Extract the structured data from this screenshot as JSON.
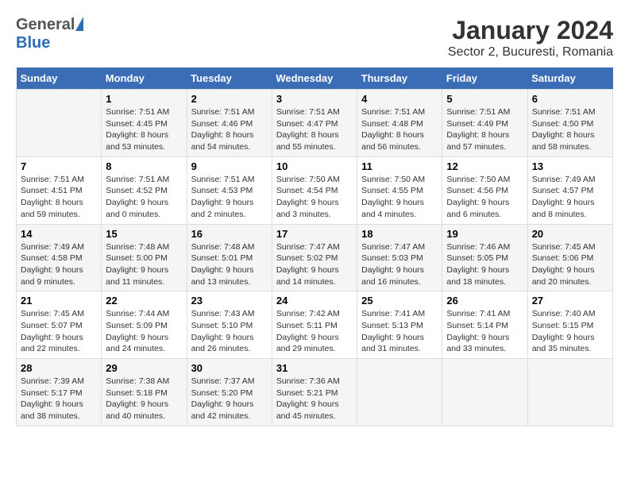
{
  "logo": {
    "general": "General",
    "blue": "Blue"
  },
  "title": "January 2024",
  "subtitle": "Sector 2, Bucuresti, Romania",
  "days_of_week": [
    "Sunday",
    "Monday",
    "Tuesday",
    "Wednesday",
    "Thursday",
    "Friday",
    "Saturday"
  ],
  "weeks": [
    [
      {
        "day": "",
        "info": ""
      },
      {
        "day": "1",
        "info": "Sunrise: 7:51 AM\nSunset: 4:45 PM\nDaylight: 8 hours\nand 53 minutes."
      },
      {
        "day": "2",
        "info": "Sunrise: 7:51 AM\nSunset: 4:46 PM\nDaylight: 8 hours\nand 54 minutes."
      },
      {
        "day": "3",
        "info": "Sunrise: 7:51 AM\nSunset: 4:47 PM\nDaylight: 8 hours\nand 55 minutes."
      },
      {
        "day": "4",
        "info": "Sunrise: 7:51 AM\nSunset: 4:48 PM\nDaylight: 8 hours\nand 56 minutes."
      },
      {
        "day": "5",
        "info": "Sunrise: 7:51 AM\nSunset: 4:49 PM\nDaylight: 8 hours\nand 57 minutes."
      },
      {
        "day": "6",
        "info": "Sunrise: 7:51 AM\nSunset: 4:50 PM\nDaylight: 8 hours\nand 58 minutes."
      }
    ],
    [
      {
        "day": "7",
        "info": "Sunrise: 7:51 AM\nSunset: 4:51 PM\nDaylight: 8 hours\nand 59 minutes."
      },
      {
        "day": "8",
        "info": "Sunrise: 7:51 AM\nSunset: 4:52 PM\nDaylight: 9 hours\nand 0 minutes."
      },
      {
        "day": "9",
        "info": "Sunrise: 7:51 AM\nSunset: 4:53 PM\nDaylight: 9 hours\nand 2 minutes."
      },
      {
        "day": "10",
        "info": "Sunrise: 7:50 AM\nSunset: 4:54 PM\nDaylight: 9 hours\nand 3 minutes."
      },
      {
        "day": "11",
        "info": "Sunrise: 7:50 AM\nSunset: 4:55 PM\nDaylight: 9 hours\nand 4 minutes."
      },
      {
        "day": "12",
        "info": "Sunrise: 7:50 AM\nSunset: 4:56 PM\nDaylight: 9 hours\nand 6 minutes."
      },
      {
        "day": "13",
        "info": "Sunrise: 7:49 AM\nSunset: 4:57 PM\nDaylight: 9 hours\nand 8 minutes."
      }
    ],
    [
      {
        "day": "14",
        "info": "Sunrise: 7:49 AM\nSunset: 4:58 PM\nDaylight: 9 hours\nand 9 minutes."
      },
      {
        "day": "15",
        "info": "Sunrise: 7:48 AM\nSunset: 5:00 PM\nDaylight: 9 hours\nand 11 minutes."
      },
      {
        "day": "16",
        "info": "Sunrise: 7:48 AM\nSunset: 5:01 PM\nDaylight: 9 hours\nand 13 minutes."
      },
      {
        "day": "17",
        "info": "Sunrise: 7:47 AM\nSunset: 5:02 PM\nDaylight: 9 hours\nand 14 minutes."
      },
      {
        "day": "18",
        "info": "Sunrise: 7:47 AM\nSunset: 5:03 PM\nDaylight: 9 hours\nand 16 minutes."
      },
      {
        "day": "19",
        "info": "Sunrise: 7:46 AM\nSunset: 5:05 PM\nDaylight: 9 hours\nand 18 minutes."
      },
      {
        "day": "20",
        "info": "Sunrise: 7:45 AM\nSunset: 5:06 PM\nDaylight: 9 hours\nand 20 minutes."
      }
    ],
    [
      {
        "day": "21",
        "info": "Sunrise: 7:45 AM\nSunset: 5:07 PM\nDaylight: 9 hours\nand 22 minutes."
      },
      {
        "day": "22",
        "info": "Sunrise: 7:44 AM\nSunset: 5:09 PM\nDaylight: 9 hours\nand 24 minutes."
      },
      {
        "day": "23",
        "info": "Sunrise: 7:43 AM\nSunset: 5:10 PM\nDaylight: 9 hours\nand 26 minutes."
      },
      {
        "day": "24",
        "info": "Sunrise: 7:42 AM\nSunset: 5:11 PM\nDaylight: 9 hours\nand 29 minutes."
      },
      {
        "day": "25",
        "info": "Sunrise: 7:41 AM\nSunset: 5:13 PM\nDaylight: 9 hours\nand 31 minutes."
      },
      {
        "day": "26",
        "info": "Sunrise: 7:41 AM\nSunset: 5:14 PM\nDaylight: 9 hours\nand 33 minutes."
      },
      {
        "day": "27",
        "info": "Sunrise: 7:40 AM\nSunset: 5:15 PM\nDaylight: 9 hours\nand 35 minutes."
      }
    ],
    [
      {
        "day": "28",
        "info": "Sunrise: 7:39 AM\nSunset: 5:17 PM\nDaylight: 9 hours\nand 38 minutes."
      },
      {
        "day": "29",
        "info": "Sunrise: 7:38 AM\nSunset: 5:18 PM\nDaylight: 9 hours\nand 40 minutes."
      },
      {
        "day": "30",
        "info": "Sunrise: 7:37 AM\nSunset: 5:20 PM\nDaylight: 9 hours\nand 42 minutes."
      },
      {
        "day": "31",
        "info": "Sunrise: 7:36 AM\nSunset: 5:21 PM\nDaylight: 9 hours\nand 45 minutes."
      },
      {
        "day": "",
        "info": ""
      },
      {
        "day": "",
        "info": ""
      },
      {
        "day": "",
        "info": ""
      }
    ]
  ]
}
